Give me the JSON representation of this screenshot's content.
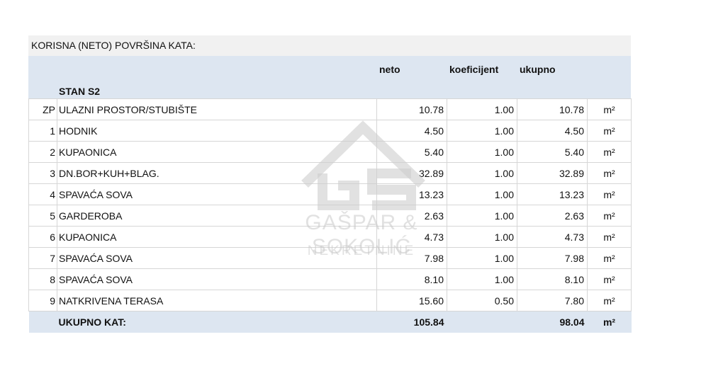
{
  "title": "KORISNA (NETO) POVRŠINA KATA:",
  "headers": {
    "neto": "neto",
    "koeficijent": "koeficijent",
    "ukupno": "ukupno"
  },
  "section": "STAN S2",
  "rows": [
    {
      "num": "ZP",
      "name": "ULAZNI PROSTOR/STUBIŠTE",
      "neto": "10.78",
      "koef": "1.00",
      "ukupno": "10.78",
      "unit": "m²"
    },
    {
      "num": "1",
      "name": "HODNIK",
      "neto": "4.50",
      "koef": "1.00",
      "ukupno": "4.50",
      "unit": "m²"
    },
    {
      "num": "2",
      "name": "KUPAONICA",
      "neto": "5.40",
      "koef": "1.00",
      "ukupno": "5.40",
      "unit": "m²"
    },
    {
      "num": "3",
      "name": "DN.BOR+KUH+BLAG.",
      "neto": "32.89",
      "koef": "1.00",
      "ukupno": "32.89",
      "unit": "m²"
    },
    {
      "num": "4",
      "name": "SPAVAĆA SOVA",
      "neto": "13.23",
      "koef": "1.00",
      "ukupno": "13.23",
      "unit": "m²"
    },
    {
      "num": "5",
      "name": "GARDEROBA",
      "neto": "2.63",
      "koef": "1.00",
      "ukupno": "2.63",
      "unit": "m²"
    },
    {
      "num": "6",
      "name": "KUPAONICA",
      "neto": "4.73",
      "koef": "1.00",
      "ukupno": "4.73",
      "unit": "m²"
    },
    {
      "num": "7",
      "name": "SPAVAĆA SOVA",
      "neto": "7.98",
      "koef": "1.00",
      "ukupno": "7.98",
      "unit": "m²"
    },
    {
      "num": "8",
      "name": "SPAVAĆA SOVA",
      "neto": "8.10",
      "koef": "1.00",
      "ukupno": "8.10",
      "unit": "m²"
    },
    {
      "num": "9",
      "name": "NATKRIVENA TERASA",
      "neto": "15.60",
      "koef": "0.50",
      "ukupno": "7.80",
      "unit": "m²"
    }
  ],
  "total": {
    "label": "UKUPNO KAT:",
    "neto": "105.84",
    "ukupno": "98.04",
    "unit": "m²"
  },
  "watermark": {
    "name": "GAŠPAR & SOKOLIĆ",
    "sub": "NEKRETNINE",
    "logo_icon": "house-logo-icon"
  }
}
